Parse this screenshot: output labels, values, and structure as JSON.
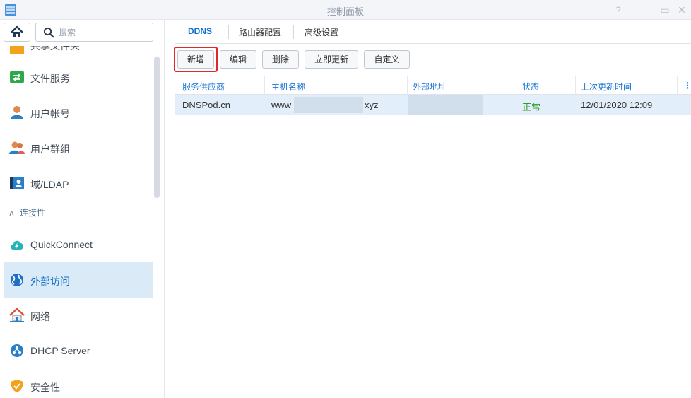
{
  "window": {
    "title": "控制面板",
    "controls": [
      "help-icon",
      "minimize-icon",
      "maximize-icon",
      "close-icon"
    ]
  },
  "sidebar": {
    "search_placeholder": "搜索",
    "items": [
      {
        "label": "共享文件夹",
        "icon": "folder-share-icon",
        "partial": true
      },
      {
        "label": "文件服务",
        "icon": "file-services-icon"
      },
      {
        "label": "用户帐号",
        "icon": "user-icon"
      },
      {
        "label": "用户群组",
        "icon": "group-icon"
      },
      {
        "label": "域/LDAP",
        "icon": "domain-ldap-icon"
      },
      {
        "label": "QuickConnect",
        "icon": "quickconnect-icon"
      },
      {
        "label": "外部访问",
        "icon": "globe-icon",
        "active": true
      },
      {
        "label": "网络",
        "icon": "network-house-icon"
      },
      {
        "label": "DHCP Server",
        "icon": "dhcp-icon"
      },
      {
        "label": "安全性",
        "icon": "shield-icon"
      }
    ],
    "section_header": "连接性"
  },
  "tabs": [
    {
      "label": "DDNS",
      "active": true
    },
    {
      "label": "路由器配置"
    },
    {
      "label": "高级设置"
    }
  ],
  "toolbar": {
    "add": "新增",
    "edit": "编辑",
    "delete": "删除",
    "update_now": "立即更新",
    "customize": "自定义"
  },
  "table": {
    "columns": [
      "服务供应商",
      "主机名称",
      "外部地址",
      "状态",
      "上次更新时间"
    ],
    "rows": [
      {
        "provider": "DNSPod.cn",
        "hostname_prefix": "www",
        "hostname_suffix": "xyz",
        "external_address": "",
        "status": "正常",
        "last_update": "12/01/2020 12:09"
      }
    ]
  },
  "colors": {
    "accent": "#0c6fcf",
    "active_bg": "#dbeaf7",
    "status_ok": "#2f9a2f",
    "highlight_box": "#e3262a"
  }
}
